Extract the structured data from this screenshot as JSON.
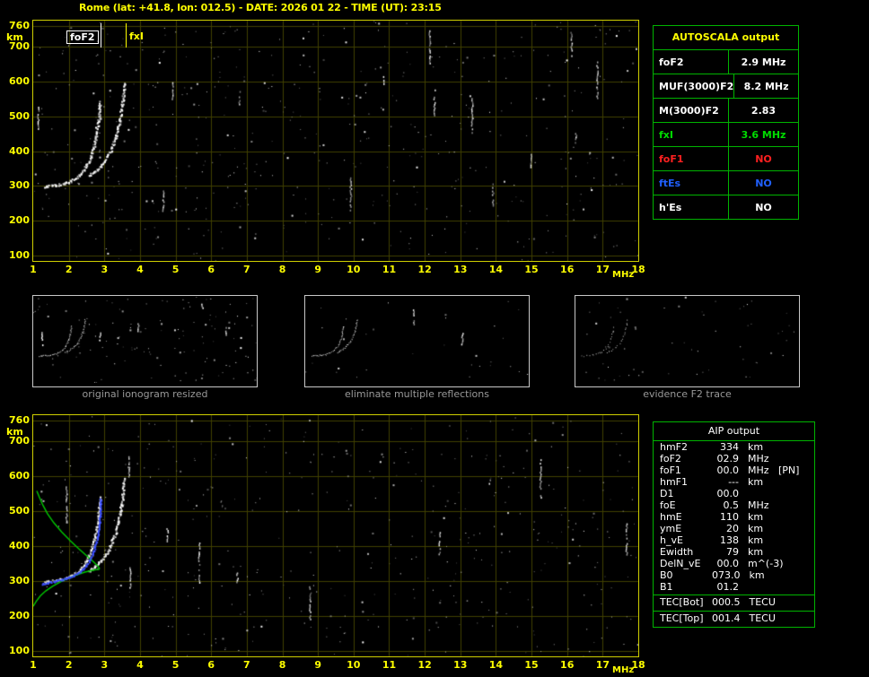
{
  "title": "Rome (lat: +41.8, lon: 012.5) - DATE: 2026 01 22 - TIME (UT): 23:15",
  "colors": {
    "accent_yellow": "#ffff00",
    "plot_border": "#cfcf00",
    "grid": "#404000",
    "table_green": "#00b400",
    "trace_white": "#ffffff",
    "profile_green": "#00c800",
    "fitted_blue": "#3c50ff",
    "caption_gray": "#999999",
    "no_red": "#ff2020",
    "es_blue": "#2060ff",
    "fxi_green": "#00dc00"
  },
  "top_plot": {
    "y_unit": "km",
    "x_unit": "MHz",
    "y_ticks": [
      760,
      700,
      600,
      500,
      400,
      300,
      200,
      100
    ],
    "x_ticks": [
      1,
      2,
      3,
      4,
      5,
      6,
      7,
      8,
      9,
      10,
      11,
      12,
      13,
      14,
      15,
      16,
      17,
      18
    ],
    "markers": [
      {
        "label": "foF2",
        "freq_mhz": 2.9,
        "color": "#ffffff",
        "boxed": true,
        "side": "left"
      },
      {
        "label": "fxI",
        "freq_mhz": 3.6,
        "color": "#ffff00",
        "boxed": false,
        "side": "right"
      }
    ],
    "traces": [
      {
        "name": "F2-ordinary-trace",
        "points": [
          [
            1.3,
            300
          ],
          [
            1.55,
            303
          ],
          [
            1.8,
            307
          ],
          [
            2.0,
            313
          ],
          [
            2.2,
            325
          ],
          [
            2.4,
            345
          ],
          [
            2.55,
            372
          ],
          [
            2.68,
            408
          ],
          [
            2.78,
            455
          ],
          [
            2.84,
            505
          ],
          [
            2.87,
            545
          ]
        ]
      },
      {
        "name": "F2-extraordinary-trace",
        "points": [
          [
            2.55,
            330
          ],
          [
            2.75,
            345
          ],
          [
            2.95,
            368
          ],
          [
            3.15,
            400
          ],
          [
            3.3,
            440
          ],
          [
            3.42,
            490
          ],
          [
            3.5,
            545
          ],
          [
            3.55,
            600
          ]
        ]
      }
    ]
  },
  "autoscala": {
    "header": "AUTOSCALA output",
    "rows": [
      {
        "label": "foF2",
        "value": "2.9 MHz",
        "color": "#ffffff"
      },
      {
        "label": "MUF(3000)F2",
        "value": "8.2 MHz",
        "color": "#ffffff"
      },
      {
        "label": "M(3000)F2",
        "value": "2.83",
        "color": "#ffffff"
      },
      {
        "label": "fxI",
        "value": "3.6 MHz",
        "color": "#00dc00"
      },
      {
        "label": "foF1",
        "value": "NO",
        "color": "#ff2020"
      },
      {
        "label": "ftEs",
        "value": "NO",
        "color": "#2060ff"
      },
      {
        "label": "h'Es",
        "value": "NO",
        "color": "#ffffff"
      }
    ]
  },
  "panels": [
    {
      "caption": "original ionogram resized"
    },
    {
      "caption": "eliminate multiple reflections"
    },
    {
      "caption": "evidence F2 trace"
    }
  ],
  "bottom_plot": {
    "y_unit": "km",
    "x_unit": "MHz",
    "y_ticks": [
      760,
      700,
      600,
      500,
      400,
      300,
      200,
      100
    ],
    "x_ticks": [
      1,
      2,
      3,
      4,
      5,
      6,
      7,
      8,
      9,
      10,
      11,
      12,
      13,
      14,
      15,
      16,
      17,
      18
    ],
    "traces": [
      {
        "name": "F2-ordinary-trace",
        "points": [
          [
            1.3,
            300
          ],
          [
            1.55,
            303
          ],
          [
            1.8,
            307
          ],
          [
            2.0,
            313
          ],
          [
            2.2,
            325
          ],
          [
            2.4,
            345
          ],
          [
            2.55,
            372
          ],
          [
            2.68,
            408
          ],
          [
            2.78,
            455
          ],
          [
            2.84,
            505
          ],
          [
            2.87,
            545
          ]
        ]
      },
      {
        "name": "F2-extraordinary-trace",
        "points": [
          [
            2.55,
            330
          ],
          [
            2.75,
            345
          ],
          [
            2.95,
            368
          ],
          [
            3.15,
            400
          ],
          [
            3.3,
            440
          ],
          [
            3.42,
            490
          ],
          [
            3.5,
            545
          ],
          [
            3.55,
            600
          ]
        ]
      }
    ],
    "overlays": [
      {
        "name": "electron-density-profile",
        "type": "line",
        "color": "#00c800",
        "points": [
          [
            1.0,
            228
          ],
          [
            1.08,
            242
          ],
          [
            1.2,
            258
          ],
          [
            1.35,
            272
          ],
          [
            1.55,
            286
          ],
          [
            1.78,
            299
          ],
          [
            2.02,
            310
          ],
          [
            2.25,
            319
          ],
          [
            2.45,
            326
          ],
          [
            2.62,
            330
          ],
          [
            2.76,
            333
          ],
          [
            2.85,
            334
          ],
          [
            2.86,
            337
          ],
          [
            2.8,
            345
          ],
          [
            2.68,
            357
          ],
          [
            2.5,
            373
          ],
          [
            2.28,
            393
          ],
          [
            2.04,
            416
          ],
          [
            1.8,
            441
          ],
          [
            1.58,
            467
          ],
          [
            1.4,
            493
          ],
          [
            1.27,
            518
          ],
          [
            1.17,
            541
          ],
          [
            1.1,
            558
          ]
        ]
      },
      {
        "name": "fitted-h-f-trace",
        "type": "dots",
        "color": "#3c50ff",
        "points": [
          [
            1.25,
            293
          ],
          [
            1.45,
            298
          ],
          [
            1.7,
            303
          ],
          [
            1.95,
            310
          ],
          [
            2.18,
            320
          ],
          [
            2.38,
            335
          ],
          [
            2.55,
            356
          ],
          [
            2.68,
            385
          ],
          [
            2.78,
            422
          ],
          [
            2.84,
            462
          ],
          [
            2.87,
            505
          ],
          [
            2.88,
            540
          ]
        ]
      }
    ]
  },
  "aip": {
    "header": "AIP output",
    "rows": [
      {
        "label": "hmF2",
        "value": "334",
        "unit": "km",
        "note": ""
      },
      {
        "label": "foF2",
        "value": "02.9",
        "unit": "MHz",
        "note": ""
      },
      {
        "label": "foF1",
        "value": "00.0",
        "unit": "MHz",
        "note": "[PN]"
      },
      {
        "label": "hmF1",
        "value": "---",
        "unit": "km",
        "note": ""
      },
      {
        "label": "D1",
        "value": "00.0",
        "unit": "",
        "note": ""
      },
      {
        "label": "foE",
        "value": "0.5",
        "unit": "MHz",
        "note": ""
      },
      {
        "label": "hmE",
        "value": "110",
        "unit": "km",
        "note": ""
      },
      {
        "label": "ymE",
        "value": "20",
        "unit": "km",
        "note": ""
      },
      {
        "label": "h_vE",
        "value": "138",
        "unit": "km",
        "note": ""
      },
      {
        "label": "Ewidth",
        "value": "79",
        "unit": "km",
        "note": ""
      },
      {
        "label": "DelN_vE",
        "value": "00.0",
        "unit": "m^(-3)",
        "note": ""
      },
      {
        "label": "B0",
        "value": "073.0",
        "unit": "km",
        "note": ""
      },
      {
        "label": "B1",
        "value": "01.2",
        "unit": "",
        "note": ""
      }
    ],
    "tec_rows": [
      {
        "label": "TEC[Bot]",
        "value": "000.5",
        "unit": "TECU"
      },
      {
        "label": "TEC[Top]",
        "value": "001.4",
        "unit": "TECU"
      }
    ]
  }
}
